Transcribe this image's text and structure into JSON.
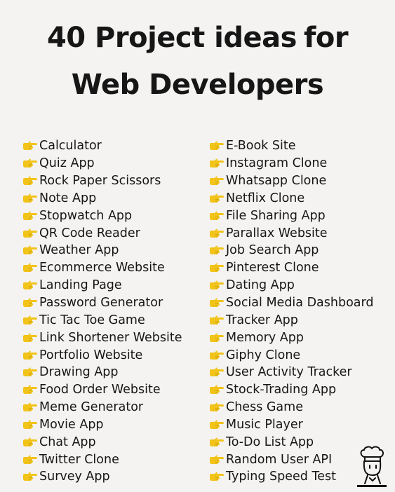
{
  "title": {
    "line1": "40 Project ideas",
    "line1_suffix": "for",
    "line2": "Web Developers"
  },
  "bullet_icon": "pointing-hand-icon",
  "colors": {
    "background": "#f4f3f1",
    "text": "#161616",
    "bullet": "#f2c318"
  },
  "left_column": [
    "Calculator",
    "Quiz App",
    "Rock Paper Scissors",
    "Note App",
    "Stopwatch App",
    "QR Code Reader",
    "Weather App",
    "Ecommerce Website",
    "Landing Page",
    "Password Generator",
    "Tic Tac Toe Game",
    "Link Shortener Website",
    "Portfolio Website",
    "Drawing App",
    "Food Order Website",
    "Meme Generator",
    "Movie App",
    "Chat App",
    "Twitter Clone",
    "Survey App"
  ],
  "right_column": [
    "E-Book Site",
    "Instagram Clone",
    "Whatsapp Clone",
    "Netflix Clone",
    "File Sharing App",
    "Parallax Website",
    "Job Search App",
    "Pinterest Clone",
    "Dating App",
    "Social Media Dashboard",
    "Tracker App",
    "Memory App",
    "Giphy Clone",
    "User Activity Tracker",
    "Stock-Trading App",
    "Chess Game",
    "Music Player",
    "To-Do List App",
    "Random User API",
    "Typing Speed Test"
  ],
  "logo_icon": "chef-character-icon"
}
